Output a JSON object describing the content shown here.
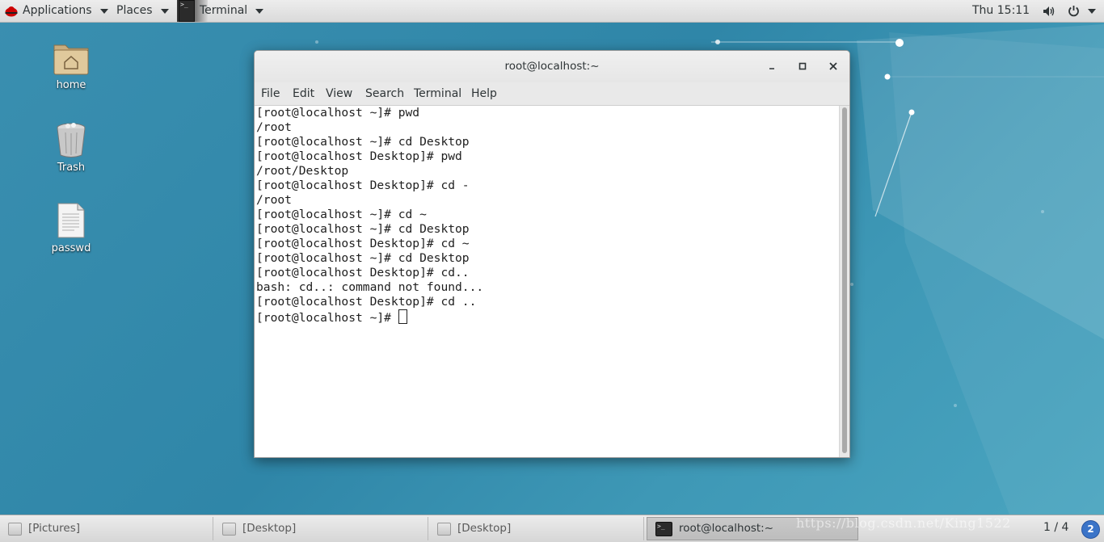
{
  "topbar": {
    "applications_label": "Applications",
    "places_label": "Places",
    "app_label": "Terminal",
    "clock": "Thu 15:11"
  },
  "desktop": {
    "icons": [
      {
        "label": "home"
      },
      {
        "label": "Trash"
      },
      {
        "label": "passwd"
      }
    ]
  },
  "window": {
    "title": "root@localhost:~",
    "menu": [
      "File",
      "Edit",
      "View",
      "Search",
      "Terminal",
      "Help"
    ],
    "lines": [
      "[root@localhost ~]# pwd",
      "/root",
      "[root@localhost ~]# cd Desktop",
      "[root@localhost Desktop]# pwd",
      "/root/Desktop",
      "[root@localhost Desktop]# cd -",
      "/root",
      "[root@localhost ~]# cd ~",
      "[root@localhost ~]# cd Desktop",
      "[root@localhost Desktop]# cd ~",
      "[root@localhost ~]# cd Desktop",
      "[root@localhost Desktop]# cd..",
      "bash: cd..: command not found...",
      "[root@localhost Desktop]# cd ..",
      "[root@localhost ~]# "
    ]
  },
  "taskbar": {
    "tasks": [
      {
        "label": "[Pictures]"
      },
      {
        "label": "[Desktop]"
      },
      {
        "label": "[Desktop]"
      },
      {
        "label": "root@localhost:~"
      }
    ],
    "watermark": "https://blog.csdn.net/King1522",
    "pager": "1 / 4",
    "workspace_badge": "2"
  },
  "colors": {
    "desktop_bg": "#3a8fb0",
    "accent_badge": "#3b74c8"
  }
}
